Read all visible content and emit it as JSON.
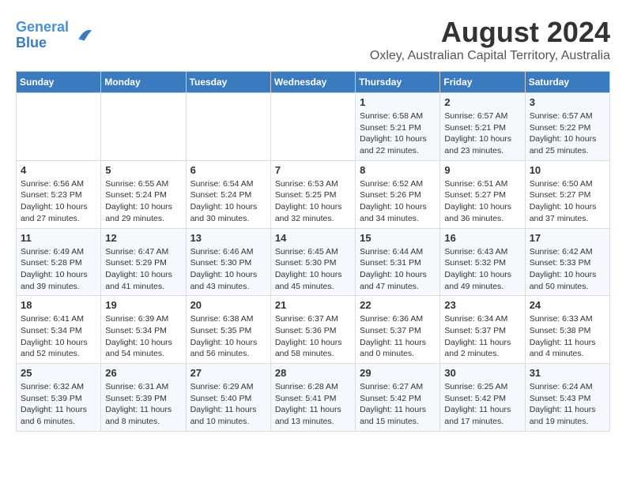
{
  "logo": {
    "line1": "General",
    "line2": "Blue"
  },
  "title": "August 2024",
  "subtitle": "Oxley, Australian Capital Territory, Australia",
  "days_of_week": [
    "Sunday",
    "Monday",
    "Tuesday",
    "Wednesday",
    "Thursday",
    "Friday",
    "Saturday"
  ],
  "weeks": [
    [
      {
        "day": "",
        "info": ""
      },
      {
        "day": "",
        "info": ""
      },
      {
        "day": "",
        "info": ""
      },
      {
        "day": "",
        "info": ""
      },
      {
        "day": "1",
        "info": "Sunrise: 6:58 AM\nSunset: 5:21 PM\nDaylight: 10 hours\nand 22 minutes."
      },
      {
        "day": "2",
        "info": "Sunrise: 6:57 AM\nSunset: 5:21 PM\nDaylight: 10 hours\nand 23 minutes."
      },
      {
        "day": "3",
        "info": "Sunrise: 6:57 AM\nSunset: 5:22 PM\nDaylight: 10 hours\nand 25 minutes."
      }
    ],
    [
      {
        "day": "4",
        "info": "Sunrise: 6:56 AM\nSunset: 5:23 PM\nDaylight: 10 hours\nand 27 minutes."
      },
      {
        "day": "5",
        "info": "Sunrise: 6:55 AM\nSunset: 5:24 PM\nDaylight: 10 hours\nand 29 minutes."
      },
      {
        "day": "6",
        "info": "Sunrise: 6:54 AM\nSunset: 5:24 PM\nDaylight: 10 hours\nand 30 minutes."
      },
      {
        "day": "7",
        "info": "Sunrise: 6:53 AM\nSunset: 5:25 PM\nDaylight: 10 hours\nand 32 minutes."
      },
      {
        "day": "8",
        "info": "Sunrise: 6:52 AM\nSunset: 5:26 PM\nDaylight: 10 hours\nand 34 minutes."
      },
      {
        "day": "9",
        "info": "Sunrise: 6:51 AM\nSunset: 5:27 PM\nDaylight: 10 hours\nand 36 minutes."
      },
      {
        "day": "10",
        "info": "Sunrise: 6:50 AM\nSunset: 5:27 PM\nDaylight: 10 hours\nand 37 minutes."
      }
    ],
    [
      {
        "day": "11",
        "info": "Sunrise: 6:49 AM\nSunset: 5:28 PM\nDaylight: 10 hours\nand 39 minutes."
      },
      {
        "day": "12",
        "info": "Sunrise: 6:47 AM\nSunset: 5:29 PM\nDaylight: 10 hours\nand 41 minutes."
      },
      {
        "day": "13",
        "info": "Sunrise: 6:46 AM\nSunset: 5:30 PM\nDaylight: 10 hours\nand 43 minutes."
      },
      {
        "day": "14",
        "info": "Sunrise: 6:45 AM\nSunset: 5:30 PM\nDaylight: 10 hours\nand 45 minutes."
      },
      {
        "day": "15",
        "info": "Sunrise: 6:44 AM\nSunset: 5:31 PM\nDaylight: 10 hours\nand 47 minutes."
      },
      {
        "day": "16",
        "info": "Sunrise: 6:43 AM\nSunset: 5:32 PM\nDaylight: 10 hours\nand 49 minutes."
      },
      {
        "day": "17",
        "info": "Sunrise: 6:42 AM\nSunset: 5:33 PM\nDaylight: 10 hours\nand 50 minutes."
      }
    ],
    [
      {
        "day": "18",
        "info": "Sunrise: 6:41 AM\nSunset: 5:34 PM\nDaylight: 10 hours\nand 52 minutes."
      },
      {
        "day": "19",
        "info": "Sunrise: 6:39 AM\nSunset: 5:34 PM\nDaylight: 10 hours\nand 54 minutes."
      },
      {
        "day": "20",
        "info": "Sunrise: 6:38 AM\nSunset: 5:35 PM\nDaylight: 10 hours\nand 56 minutes."
      },
      {
        "day": "21",
        "info": "Sunrise: 6:37 AM\nSunset: 5:36 PM\nDaylight: 10 hours\nand 58 minutes."
      },
      {
        "day": "22",
        "info": "Sunrise: 6:36 AM\nSunset: 5:37 PM\nDaylight: 11 hours\nand 0 minutes."
      },
      {
        "day": "23",
        "info": "Sunrise: 6:34 AM\nSunset: 5:37 PM\nDaylight: 11 hours\nand 2 minutes."
      },
      {
        "day": "24",
        "info": "Sunrise: 6:33 AM\nSunset: 5:38 PM\nDaylight: 11 hours\nand 4 minutes."
      }
    ],
    [
      {
        "day": "25",
        "info": "Sunrise: 6:32 AM\nSunset: 5:39 PM\nDaylight: 11 hours\nand 6 minutes."
      },
      {
        "day": "26",
        "info": "Sunrise: 6:31 AM\nSunset: 5:39 PM\nDaylight: 11 hours\nand 8 minutes."
      },
      {
        "day": "27",
        "info": "Sunrise: 6:29 AM\nSunset: 5:40 PM\nDaylight: 11 hours\nand 10 minutes."
      },
      {
        "day": "28",
        "info": "Sunrise: 6:28 AM\nSunset: 5:41 PM\nDaylight: 11 hours\nand 13 minutes."
      },
      {
        "day": "29",
        "info": "Sunrise: 6:27 AM\nSunset: 5:42 PM\nDaylight: 11 hours\nand 15 minutes."
      },
      {
        "day": "30",
        "info": "Sunrise: 6:25 AM\nSunset: 5:42 PM\nDaylight: 11 hours\nand 17 minutes."
      },
      {
        "day": "31",
        "info": "Sunrise: 6:24 AM\nSunset: 5:43 PM\nDaylight: 11 hours\nand 19 minutes."
      }
    ]
  ]
}
